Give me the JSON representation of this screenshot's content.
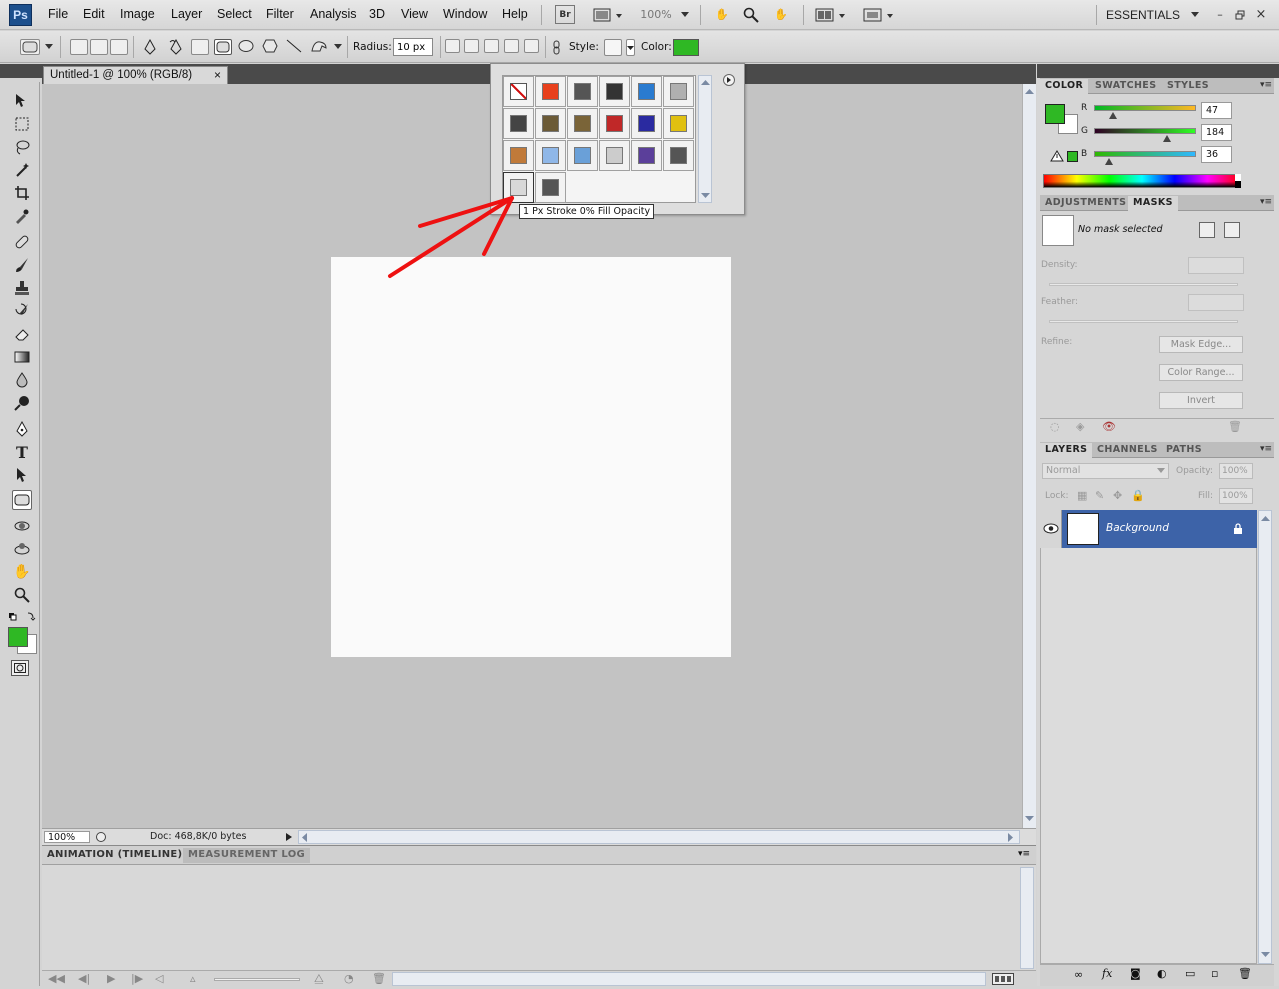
{
  "menubar": {
    "logo": "Ps",
    "items": [
      "File",
      "Edit",
      "Image",
      "Layer",
      "Select",
      "Filter",
      "Analysis",
      "3D",
      "View",
      "Window",
      "Help"
    ],
    "bridge_label": "Br",
    "zoom": "100%",
    "workspace": "ESSENTIALS"
  },
  "options": {
    "radius_label": "Radius:",
    "radius_value": "10 px",
    "style_label": "Style:",
    "color_label": "Color:",
    "color_value": "#2fb824"
  },
  "document": {
    "tab_title": "Untitled-1 @ 100% (RGB/8)",
    "close_label": "×",
    "zoom_value": "100%",
    "doc_info": "Doc: 468,8K/0 bytes"
  },
  "styles_popup": {
    "tooltip": "1 Px Stroke 0% Fill Opacity",
    "swatches": [
      [
        "none",
        "#e8401c",
        "#555555",
        "#333333",
        "#2a7bd0",
        "#b0b0b0"
      ],
      [
        "#444444",
        "#6b5a36",
        "#7a6438",
        "#c02828",
        "#2a2aa0",
        "#e0c010"
      ],
      [
        "#c07a3a",
        "#8fb7e8",
        "#6aa0d8",
        "#cccccc",
        "#5b3f9a",
        "#555555"
      ],
      [
        "#d8d8d8",
        "#555555"
      ]
    ]
  },
  "bottom_panel": {
    "tabs": [
      "ANIMATION (TIMELINE)",
      "MEASUREMENT LOG"
    ]
  },
  "color_panel": {
    "tabs": [
      "COLOR",
      "SWATCHES",
      "STYLES"
    ],
    "foreground": "#2fb824",
    "r_label": "R",
    "g_label": "G",
    "b_label": "B",
    "r_value": "47",
    "g_value": "184",
    "b_value": "36"
  },
  "masks_panel": {
    "tabs": [
      "ADJUSTMENTS",
      "MASKS"
    ],
    "status": "No mask selected",
    "density_label": "Density:",
    "feather_label": "Feather:",
    "refine_label": "Refine:",
    "mask_edge": "Mask Edge...",
    "color_range": "Color Range...",
    "invert": "Invert"
  },
  "layers_panel": {
    "tabs": [
      "LAYERS",
      "CHANNELS",
      "PATHS"
    ],
    "blend_mode": "Normal",
    "opacity_label": "Opacity:",
    "opacity_value": "100%",
    "lock_label": "Lock:",
    "fill_label": "Fill:",
    "fill_value": "100%",
    "layer_name": "Background"
  }
}
